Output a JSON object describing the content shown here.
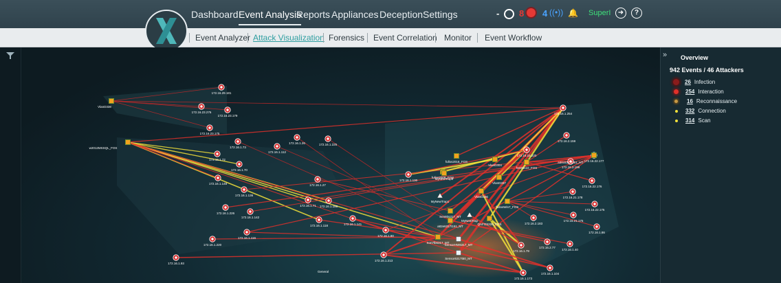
{
  "nav": {
    "top": [
      "Dashboard",
      "Event Analysis",
      "Reports",
      "Appliances",
      "Deception",
      "Settings"
    ],
    "active_top": "Event Analysis",
    "sub": [
      "Event Analyzer",
      "Attack Visualization",
      "Forensics",
      "Event Correlation",
      "Monitor",
      "Event Workflow"
    ],
    "active_sub": "Attack Visualization"
  },
  "status": {
    "pending_count": "-",
    "alerts_count": "8",
    "alerts_color": "#e53935",
    "signals_count": "4",
    "signals_color": "#4aa3ff",
    "user": "SuperI",
    "user_color": "#3ee07a"
  },
  "panel": {
    "title": "Overview",
    "summary": "942 Events / 46 Attackers",
    "legend": [
      {
        "count": "26",
        "label": "Infection",
        "color": "#8a1c1c"
      },
      {
        "count": "254",
        "label": "Interaction",
        "color": "#e0302a"
      },
      {
        "count": "16",
        "label": "Reconnaissance",
        "color": "#c79a45"
      },
      {
        "count": "332",
        "label": "Connection",
        "color": "#f3e03a"
      },
      {
        "count": "314",
        "label": "Scan",
        "color": "#f3e03a"
      }
    ]
  },
  "graph": {
    "group_label": "General",
    "hosts": [
      {
        "id": "vlan",
        "label": "VlanD338",
        "kind": "host"
      },
      {
        "id": "w2012",
        "label": "w2012MSSQL_FOS",
        "kind": "host"
      },
      {
        "id": "a30",
        "label": "a30c6317t151_MT",
        "kind": "host"
      },
      {
        "id": "fullos2016",
        "label": "fullos2016_FOS",
        "kind": "host"
      },
      {
        "id": "vlan304",
        "label": "VlanD304",
        "kind": "host"
      },
      {
        "id": "fullos2008",
        "label": "fullos2008_FOS",
        "kind": "host"
      },
      {
        "id": "mynewtrap5",
        "label": "MyNewTrap5",
        "kind": "host"
      },
      {
        "id": "fosw",
        "label": "fosWin10_FOS",
        "kind": "host"
      },
      {
        "id": "vlan337",
        "label": "VlanD337",
        "kind": "host"
      },
      {
        "id": "mynewtrap1",
        "label": "MyNewTrap1",
        "kind": "trap"
      },
      {
        "id": "vlan336",
        "label": "VlanD336",
        "kind": "host"
      },
      {
        "id": "mynewtrap",
        "label": "MyNewTrap",
        "kind": "trap"
      },
      {
        "id": "fullosw7",
        "label": "fullosWin7_FOS",
        "kind": "host"
      },
      {
        "id": "sen80",
        "label": "Sen80s317_MT",
        "kind": "host"
      },
      {
        "id": "a82",
        "label": "a82e6317t151_MT",
        "kind": "host"
      },
      {
        "id": "qa",
        "label": "QAFOS226_FOS",
        "kind": "host"
      },
      {
        "id": "son7",
        "label": "Son7lb6317_MT",
        "kind": "host"
      },
      {
        "id": "sensorhwg",
        "label": "SensorHW6317_MT",
        "kind": "sensor"
      },
      {
        "id": "sensor631",
        "label": "Sensor6317t50_MT",
        "kind": "sensor"
      }
    ],
    "attackers": [
      {
        "id": "a1",
        "label": "172.16.29.181"
      },
      {
        "id": "a2",
        "label": "172.16.23.276"
      },
      {
        "id": "a3",
        "label": "172.16.23.179"
      },
      {
        "id": "a4",
        "label": "172.16.23.175"
      },
      {
        "id": "a5",
        "label": "172.16.1.73"
      },
      {
        "id": "a6",
        "label": "172.16.1.26"
      },
      {
        "id": "a7",
        "label": "172.16.1.225"
      },
      {
        "id": "a8",
        "label": "172.16.1.112"
      },
      {
        "id": "a9",
        "label": "172.16.1.72"
      },
      {
        "id": "a10",
        "label": "172.16.1.70"
      },
      {
        "id": "a11",
        "label": "172.16.1.148"
      },
      {
        "id": "a12",
        "label": "172.16.1.136"
      },
      {
        "id": "a13",
        "label": "172.16.1.27"
      },
      {
        "id": "a14",
        "label": "172.16.1.71"
      },
      {
        "id": "a15",
        "label": "172.16.1.186"
      },
      {
        "id": "a16",
        "label": "172.16.1.226"
      },
      {
        "id": "a17",
        "label": "172.16.1.142"
      },
      {
        "id": "a18",
        "label": "172.16.1.118"
      },
      {
        "id": "a19",
        "label": "172.16.1.141"
      },
      {
        "id": "a20",
        "label": "172.16.1.116"
      },
      {
        "id": "a21",
        "label": "172.16.1.220"
      },
      {
        "id": "a22",
        "label": "172.16.1.93"
      },
      {
        "id": "a23",
        "label": "172.16.1.80"
      },
      {
        "id": "a24",
        "label": "172.16.1.213"
      },
      {
        "id": "a25",
        "label": "172.16.1.130"
      },
      {
        "id": "a26",
        "label": "172.16.1.254"
      },
      {
        "id": "a27",
        "label": "172.16.2.159"
      },
      {
        "id": "a28",
        "label": "172.16.15.220"
      },
      {
        "id": "a29",
        "label": "172.16.3.198"
      },
      {
        "id": "a30",
        "label": "172.16.22.177"
      },
      {
        "id": "a31",
        "label": "172.16.22.176"
      },
      {
        "id": "a32",
        "label": "172.16.21.178"
      },
      {
        "id": "a33",
        "label": "172.16.22.175"
      },
      {
        "id": "a34",
        "label": "172.16.2.183"
      },
      {
        "id": "a35",
        "label": "172.16.21.175"
      },
      {
        "id": "a36",
        "label": "172.16.1.86"
      },
      {
        "id": "a37",
        "label": "172.16.1.79"
      },
      {
        "id": "a38",
        "label": "172.16.2.77"
      },
      {
        "id": "a39",
        "label": "172.16.1.40"
      },
      {
        "id": "a40",
        "label": "172.16.1.173"
      },
      {
        "id": "a41",
        "label": "172.16.1.104"
      }
    ]
  }
}
